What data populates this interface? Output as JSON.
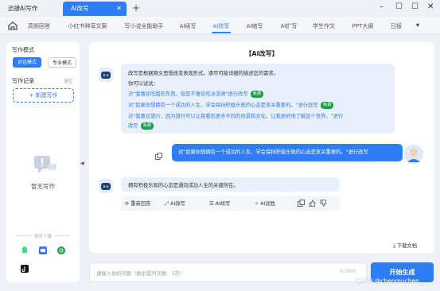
{
  "window": {
    "tabs": [
      {
        "label": "迅捷AI写作"
      },
      {
        "label": "AI改写"
      }
    ],
    "new_tab": "+",
    "minimize": "–",
    "maximize": "☐",
    "close": "✕",
    "tab_close": "✕"
  },
  "nav": {
    "items": [
      "高频回答",
      "小红书种草文案",
      "写小说全能助手",
      "AI续写",
      "AI改写",
      "AI缩写",
      "AI扩写",
      "学生作文",
      "PPT大纲",
      "日报"
    ],
    "active_index": 4,
    "more": "▾"
  },
  "sidebar": {
    "mode_title": "写作模式",
    "modes": [
      "对话模式",
      "专业模式"
    ],
    "records_title": "写作记录",
    "clear": "清空",
    "new_button": "+ 新建写作",
    "empty_text": "暂无写作",
    "download_title": "软件下载",
    "collapse": "◀"
  },
  "main": {
    "title": "【AI改写】",
    "intro": [
      "改写是根据原文思想改变表现形式。请尽可能详细的描述您的需求。",
      "你可以试试："
    ],
    "examples": [
      "对\"我喜欢吃甜的东西，但是不喜欢吃冰淇淋\"进行改写",
      "对\"如果你想拥有一个成功的人生，学会保持积极乐观的心态是至关重要的。\"进行改写",
      "对\"我喜欢旅行，因为旅行可以让我看到更多不同的风景和文化，让我更好地了解这个世界。\"进行",
      "改写"
    ],
    "free_badge": "免费",
    "user_message": "对\"如果你想拥有一个成功的人生，学会保持积极乐观的心态是至关重要的。\"进行改写",
    "answer": "拥有积极乐观的心态是通向成功人生的关键所在。",
    "actions": [
      "重新回答",
      "AI改写",
      "AI续写",
      "AI润色"
    ],
    "download_doc": "下载文档"
  },
  "input": {
    "placeholder": "请输入你的问题（剩余提问次数：1次）",
    "counter": "0/1800",
    "generate": "开始生成"
  },
  "watermark": "CSDN @chenmuchen_",
  "colors": {
    "accent": "#2f7df6",
    "free_badge": "#1aa24a"
  }
}
